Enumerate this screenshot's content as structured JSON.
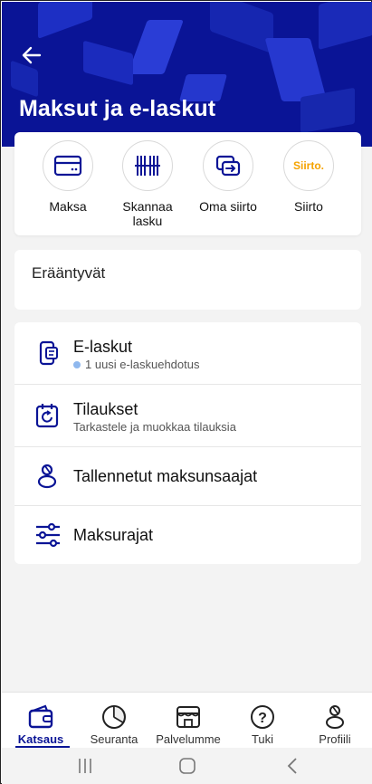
{
  "header": {
    "title": "Maksut ja e-laskut",
    "back_icon": "arrow-left-icon",
    "background_color": "#0a1496"
  },
  "quick_actions": [
    {
      "label": "Maksa",
      "icon": "card-icon"
    },
    {
      "label": "Skannaa\nlasku",
      "icon": "barcode-icon"
    },
    {
      "label": "Oma siirto",
      "icon": "transfer-icon"
    },
    {
      "label": "Siirto",
      "icon": "siirto-logo",
      "logo_text": "Siirto."
    }
  ],
  "due": {
    "title": "Erääntyvät"
  },
  "menu": [
    {
      "title": "E-laskut",
      "subtitle": "1 uusi e-laskuehdotus",
      "icon": "phone-invoice-icon",
      "has_dot": true
    },
    {
      "title": "Tilaukset",
      "subtitle": "Tarkastele ja muokkaa tilauksia",
      "icon": "calendar-refresh-icon"
    },
    {
      "title": "Tallennetut maksunsaajat",
      "icon": "person-icon"
    },
    {
      "title": "Maksurajat",
      "icon": "sliders-icon"
    }
  ],
  "bottom_nav": [
    {
      "label": "Katsaus",
      "icon": "wallet-icon",
      "active": true
    },
    {
      "label": "Seuranta",
      "icon": "pie-chart-icon"
    },
    {
      "label": "Palvelumme",
      "icon": "store-icon"
    },
    {
      "label": "Tuki",
      "icon": "help-icon"
    },
    {
      "label": "Profiili",
      "icon": "profile-icon"
    }
  ],
  "colors": {
    "accent": "#0a1496",
    "siirto_orange": "#f5a300",
    "dot_blue": "#8fb8ee"
  }
}
